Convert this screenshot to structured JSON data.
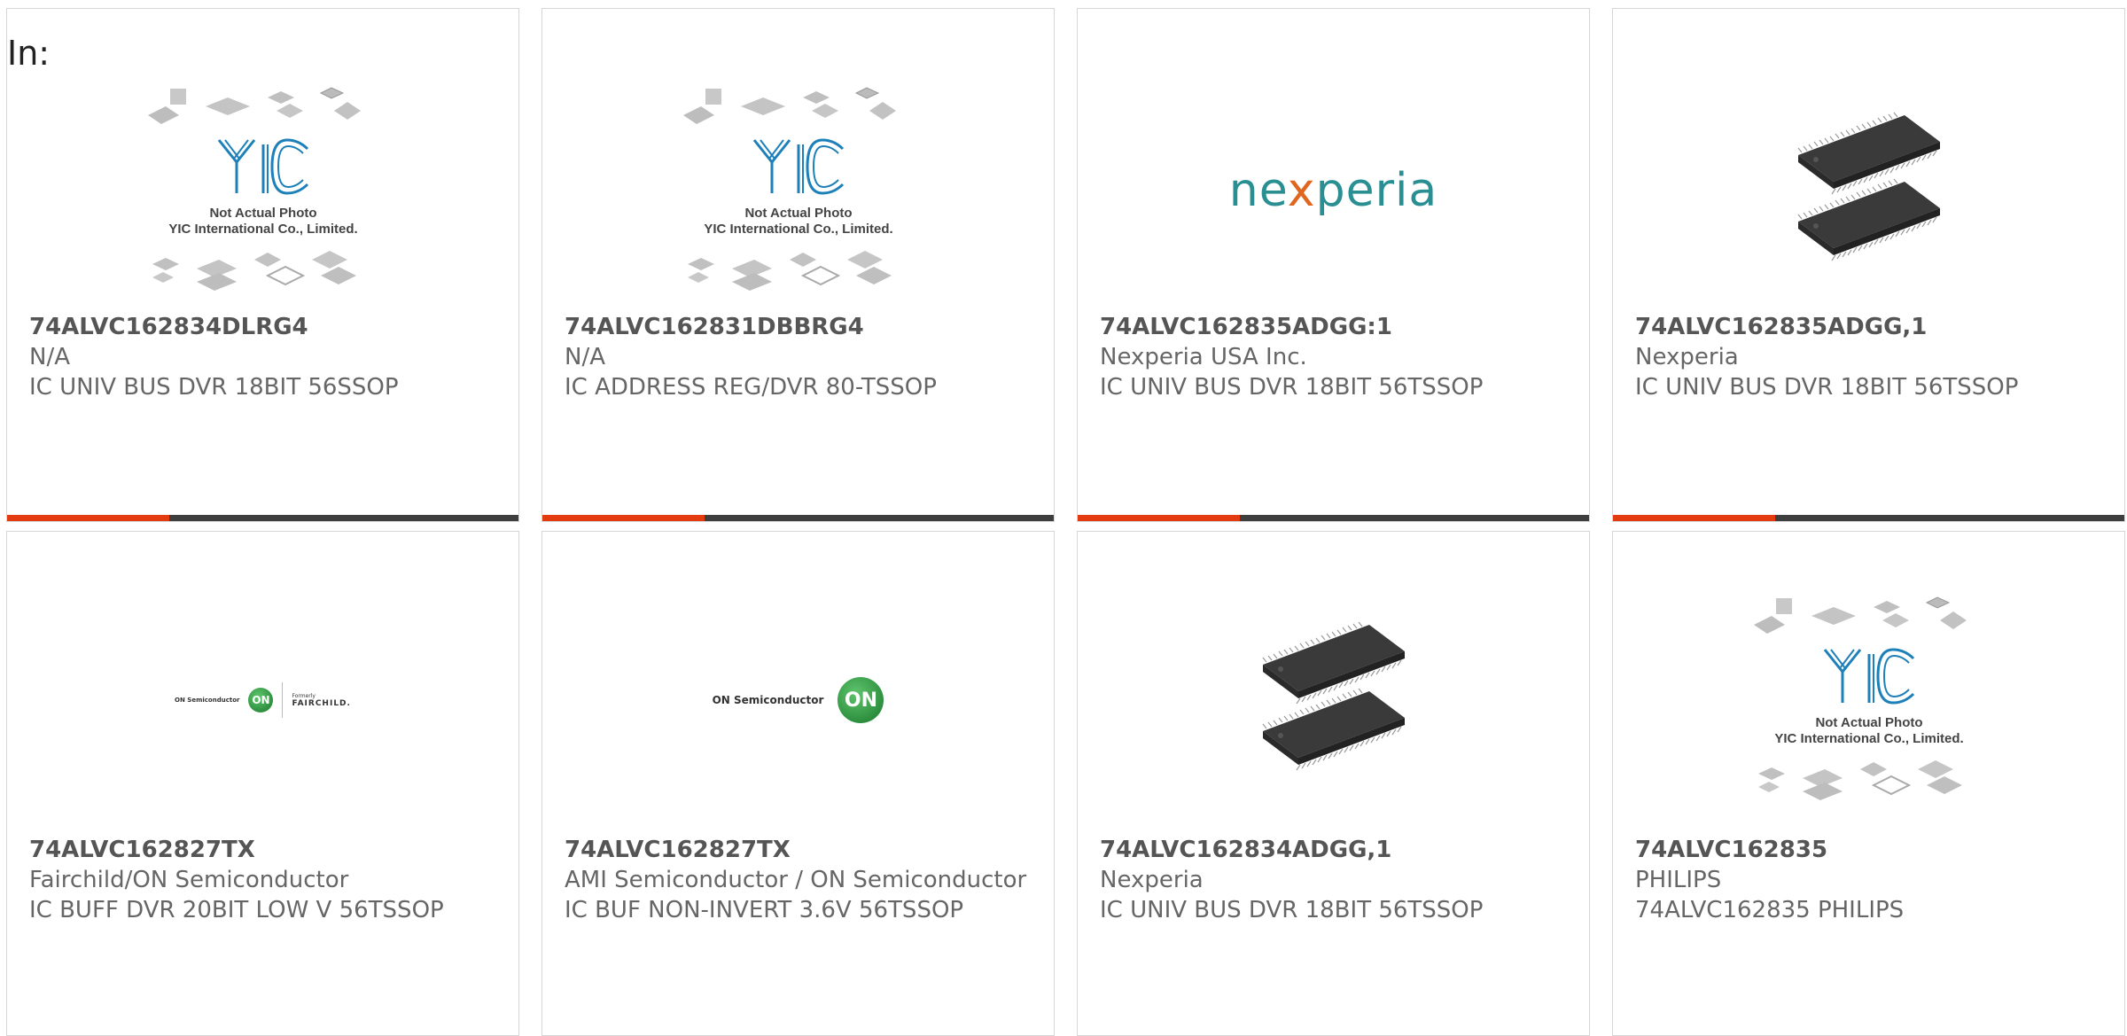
{
  "filter_label": "In:",
  "colors": {
    "accent": "#e23b0f",
    "bar": "#3e3e3e",
    "border": "#d6d6d6"
  },
  "yic": {
    "line1": "Not Actual Photo",
    "line2": "YIC International Co., Limited.",
    "logo": "YIC"
  },
  "logos": {
    "nexperia": {
      "pre": "ne",
      "x": "x",
      "post": "peria"
    },
    "on_semi": {
      "text": "ON Semiconductor",
      "mark": "ON"
    },
    "on_fairchild": {
      "text": "ON Semiconductor",
      "mark": "ON",
      "formerly": "Formerly",
      "fairchild": "FAIRCHILD."
    }
  },
  "products": [
    {
      "pn": "74ALVC162834DLRG4",
      "mfr": "N/A",
      "desc": "IC UNIV BUS DVR 18BIT 56SSOP",
      "image": "yic-placeholder"
    },
    {
      "pn": "74ALVC162831DBBRG4",
      "mfr": "N/A",
      "desc": "IC ADDRESS REG/DVR 80-TSSOP",
      "image": "yic-placeholder"
    },
    {
      "pn": "74ALVC162835ADGG:1",
      "mfr": "Nexperia USA Inc.",
      "desc": "IC UNIV BUS DVR 18BIT 56TSSOP",
      "image": "nexperia-logo"
    },
    {
      "pn": "74ALVC162835ADGG,1",
      "mfr": "Nexperia",
      "desc": "IC UNIV BUS DVR 18BIT 56TSSOP",
      "image": "tssop-chip"
    },
    {
      "pn": "74ALVC162827TX",
      "mfr": "Fairchild/ON Semiconductor",
      "desc": "IC BUFF DVR 20BIT LOW V 56TSSOP",
      "image": "on-fairchild-logo"
    },
    {
      "pn": "74ALVC162827TX",
      "mfr": "AMI Semiconductor / ON Semiconductor",
      "desc": "IC BUF NON-INVERT 3.6V 56TSSOP",
      "image": "on-semi-logo"
    },
    {
      "pn": "74ALVC162834ADGG,1",
      "mfr": "Nexperia",
      "desc": "IC UNIV BUS DVR 18BIT 56TSSOP",
      "image": "tssop-chip"
    },
    {
      "pn": "74ALVC162835",
      "mfr": "PHILIPS",
      "desc": "74ALVC162835 PHILIPS",
      "image": "yic-placeholder"
    }
  ]
}
